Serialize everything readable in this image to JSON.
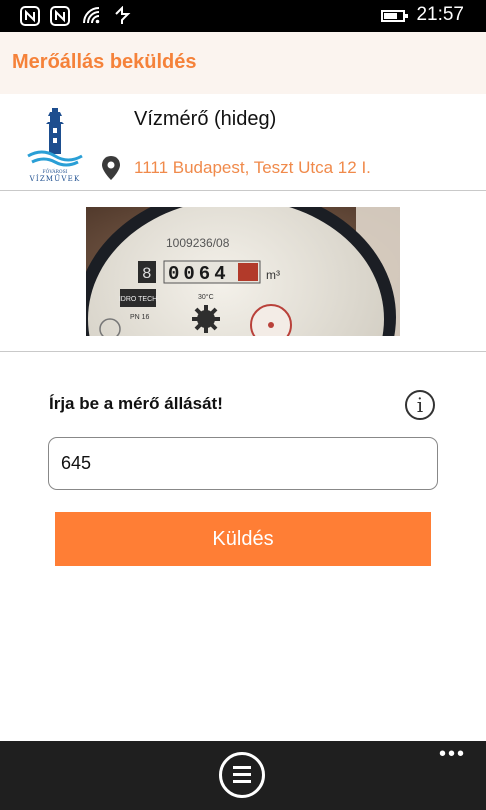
{
  "status_bar": {
    "time": "21:57",
    "icons": [
      "nfc-icon",
      "nfc-icon",
      "wifi-icon",
      "data-icon"
    ],
    "battery_level": 0.7
  },
  "header": {
    "title": "Merőállás beküldés"
  },
  "meter": {
    "name": "Vízmérő (hideg)",
    "address": "1111 Budapest, Teszt Utca 12 I.",
    "logo_text": "FŐVÁROSI VÍZMŰVEK",
    "photo_serial": "1009236/08",
    "photo_digits": "0064",
    "photo_unit": "m³",
    "photo_brand": "IDRO TECH",
    "photo_temp": "30°C",
    "photo_pn": "PN 16"
  },
  "form": {
    "prompt": "Írja be a mérő állását!",
    "info_glyph": "i",
    "reading_value": "645",
    "submit_label": "Küldés"
  },
  "appbar": {
    "more_label": "•••"
  },
  "colors": {
    "accent": "#ff7e35",
    "header_bg": "#fbf4ef",
    "address": "#f08a4b"
  }
}
